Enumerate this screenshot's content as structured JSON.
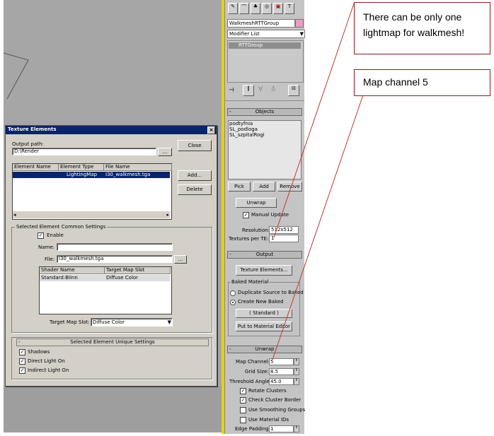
{
  "dialog": {
    "title": "Texture Elements",
    "close_x": "×",
    "output_path_label": "Output path:",
    "output_path_value": "D:\\Render",
    "browse_label": "...",
    "close_button": "Close",
    "add_button": "Add...",
    "delete_button": "Delete",
    "table": {
      "headers": [
        "Element Name",
        "Element Type",
        "File Name"
      ],
      "rows": [
        [
          "",
          "LightingMap",
          "I30_walkmesh.tga"
        ]
      ]
    },
    "common": {
      "title": "Selected Element Common Settings",
      "enable_label": "Enable",
      "name_label": "Name:",
      "name_value": "",
      "file_label": "File:",
      "file_value": "I30_walkmesh.tga",
      "file_browse": "...",
      "shader_headers": [
        "Shader Name",
        "Target Map Slot"
      ],
      "shader_rows": [
        [
          "Standard:Blinn",
          "Diffuse Color"
        ]
      ],
      "target_slot_label": "Target Map Slot:",
      "target_slot_value": "Diffuse Color"
    },
    "unique": {
      "title": "Selected Element Unique Settings",
      "shadows": "Shadows",
      "direct": "Direct Light On",
      "indirect": "Indirect Light On"
    }
  },
  "command_panel": {
    "object_name": "WalkmeshRTTGroup",
    "modifier_list": "Modifier List",
    "stack_item": "RTTGroup",
    "objects_title": "Objects",
    "objects": [
      "podtyfnia",
      "SL_podloga",
      "SL_szpitalRogi"
    ],
    "pick": "Pick",
    "add": "Add",
    "remove": "Remove",
    "unwrap_btn": "Unwrap",
    "manual_update": "Manual Update",
    "resolution_label": "Resolution:",
    "resolution_value": "512x512",
    "textures_label": "Textures per TE:",
    "textures_value": "1",
    "output_title": "Output",
    "texture_elements_btn": "Texture Elements...",
    "baked_material_title": "Baked Material",
    "duplicate_source": "Duplicate Source to Baked",
    "create_new_baked": "Create New Baked",
    "standard_btn": "( Standard )",
    "put_to_editor": "Put to Material Editor",
    "unwrap_title": "Unwrap",
    "map_channel_label": "Map Channel:",
    "map_channel_value": "5",
    "grid_size_label": "Grid Size:",
    "grid_size_value": "8.5",
    "threshold_label": "Threshold Angle:",
    "threshold_value": "45.0",
    "rotate_clusters": "Rotate Clusters",
    "check_cluster_border": "Check Cluster Border",
    "use_smoothing": "Use Smoothing Groups",
    "use_material_ids": "Use Material IDs",
    "edge_padding_label": "Edge Padding:",
    "edge_padding_value": "1"
  },
  "callouts": {
    "top": "There can be only one lightmap for walkmesh!",
    "second": "Map channel 5"
  },
  "colors": {
    "title_bar": "#0a246a",
    "callout_border": "#8b1c1c",
    "callout_line": "#c0392b",
    "viewport": "#a6a6a6",
    "yellow_bar": "#e8d200"
  }
}
